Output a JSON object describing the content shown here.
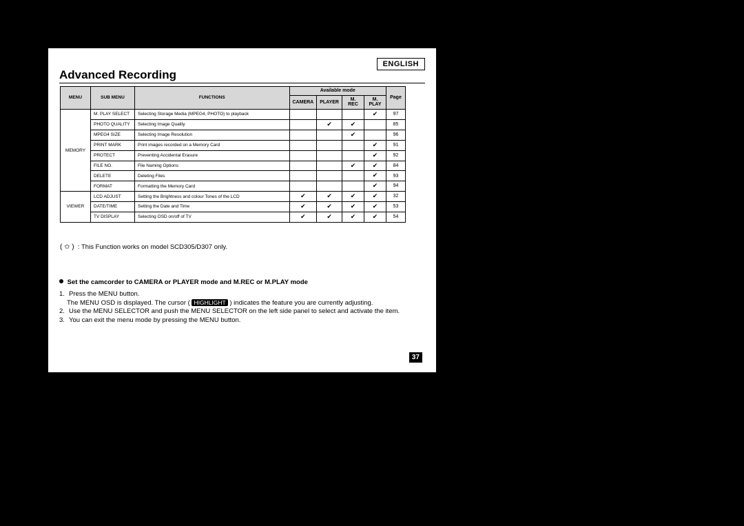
{
  "language_label": "ENGLISH",
  "title": "Advanced Recording",
  "table": {
    "headers": {
      "menu": "MENU",
      "submenu": "SUB MENU",
      "functions": "FUNCTIONS",
      "available_mode": "Available mode",
      "camera": "CAMERA",
      "player": "PLAYER",
      "mrec": "M. REC",
      "mplay": "M. PLAY",
      "page": "Page"
    },
    "groups": [
      {
        "menu": "MEMORY",
        "rows": [
          {
            "submenu": "M. PLAY SELECT",
            "functions": "Selecting Storage Media (MPEG4, PHOTO) to playback",
            "camera": "",
            "player": "",
            "mrec": "",
            "mplay": "✔",
            "page": "97"
          },
          {
            "submenu": "PHOTO QUALITY",
            "functions": "Selecting Image Quality",
            "camera": "",
            "player": "✔",
            "mrec": "✔",
            "mplay": "",
            "page": "85"
          },
          {
            "submenu": "MPEG4 SIZE",
            "functions": "Selecting Image Resolution",
            "camera": "",
            "player": "",
            "mrec": "✔",
            "mplay": "",
            "page": "96"
          },
          {
            "submenu": "PRINT MARK",
            "functions": "Print images recorded on a Memory Card",
            "camera": "",
            "player": "",
            "mrec": "",
            "mplay": "✔",
            "page": "91"
          },
          {
            "submenu": "PROTECT",
            "functions": "Preventing Accidental Erasure",
            "camera": "",
            "player": "",
            "mrec": "",
            "mplay": "✔",
            "page": "92"
          },
          {
            "submenu": "FILE NO.",
            "functions": "File Naming Options",
            "camera": "",
            "player": "",
            "mrec": "✔",
            "mplay": "✔",
            "page": "84"
          },
          {
            "submenu": "DELETE",
            "functions": "Deleting Files",
            "camera": "",
            "player": "",
            "mrec": "",
            "mplay": "✔",
            "page": "93"
          },
          {
            "submenu": "FORMAT",
            "functions": "Formatting the Memory Card",
            "camera": "",
            "player": "",
            "mrec": "",
            "mplay": "✔",
            "page": "94"
          }
        ]
      },
      {
        "menu": "VIEWER",
        "rows": [
          {
            "submenu": "LCD ADJUST",
            "functions": "Setting the Brightness and colour Tones of the LCD",
            "camera": "✔",
            "player": "✔",
            "mrec": "✔",
            "mplay": "✔",
            "page": "32"
          },
          {
            "submenu": "DATE/TIME",
            "functions": "Setting the Date and Time",
            "camera": "✔",
            "player": "✔",
            "mrec": "✔",
            "mplay": "✔",
            "page": "53"
          },
          {
            "submenu": "TV DISPLAY",
            "functions": "Selecting OSD on/off of TV",
            "camera": "✔",
            "player": "✔",
            "mrec": "✔",
            "mplay": "✔",
            "page": "54"
          }
        ]
      }
    ]
  },
  "footnote": {
    "symbol": "( ✩ )",
    "text": ": This Function works on model SCD305/D307 only."
  },
  "instructions": {
    "header": "Set the camcorder to CAMERA or PLAYER mode and M.REC or M.PLAY mode",
    "step1_a": "Press the MENU button.",
    "step1_b": "The MENU OSD is displayed. The cursor (",
    "highlight": "HIGHLIGHT",
    "step1_c": ") indicates the feature you are currently adjusting.",
    "step2": "Use the MENU SELECTOR and push the MENU SELECTOR on the left side panel to select and activate the item.",
    "step3": "You can exit the menu mode by pressing the MENU button."
  },
  "page_number": "37"
}
